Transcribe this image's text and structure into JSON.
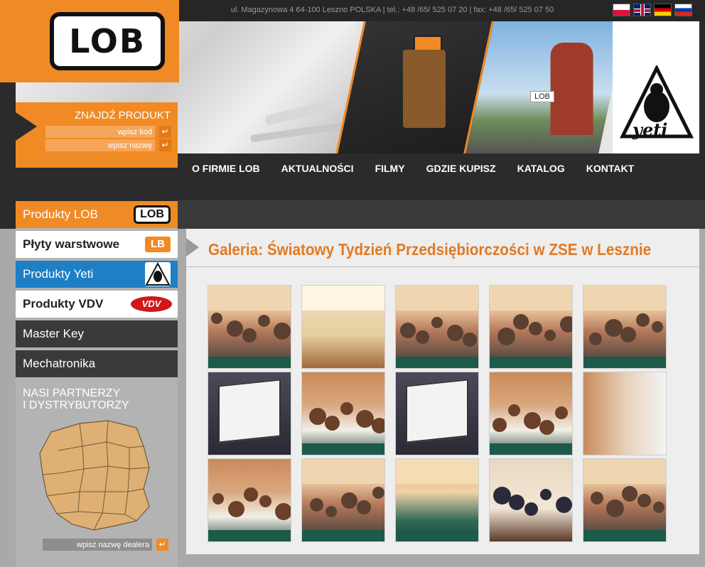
{
  "header": {
    "address": "ul. Magazynowa 4 64-100 Leszno POLSKA | tel.: +48 /65/ 525 07 20 | fax: +48 /65/ 525 07 50",
    "logo_text": "LOB",
    "flags": [
      "pl-flag-icon",
      "uk-flag-icon",
      "de-flag-icon",
      "ru-flag-icon"
    ]
  },
  "banner": {
    "lob_tag": "LOB",
    "yeti_text": "yeti"
  },
  "finder": {
    "title": "ZNAJDŹ PRODUKT",
    "code_placeholder": "wpisz kod",
    "name_placeholder": "wpisz nazwę"
  },
  "nav": {
    "items": [
      "O FIRMIE LOB",
      "AKTUALNOŚCI",
      "FILMY",
      "GDZIE KUPISZ",
      "KATALOG",
      "KONTAKT"
    ]
  },
  "sidebar": {
    "items": [
      {
        "label": "Produkty LOB",
        "badge": "LOB"
      },
      {
        "label": "Płyty warstwowe",
        "badge": "LB"
      },
      {
        "label": "Produkty Yeti",
        "badge": "yeti"
      },
      {
        "label": "Produkty VDV",
        "badge": "VDV"
      },
      {
        "label": "Master Key"
      },
      {
        "label": "Mechatronika"
      }
    ],
    "partners_title_line1": "NASI PARTNERZY",
    "partners_title_line2": "I DYSTRYBUTORZY",
    "dealer_placeholder": "wpisz nazwę dealera"
  },
  "gallery": {
    "title": "Galeria: Światowy Tydzień Przedsiębiorczości w ZSE w Lesznie",
    "thumbnails": [
      "audience-photo",
      "stage-piano-photo",
      "audience-photo",
      "audience-photo",
      "audience-photo",
      "presentation-screen-photo",
      "students-photo",
      "presentation-screen-photo",
      "students-photo",
      "lob-slide-photo",
      "students-photo",
      "audience-photo",
      "classroom-photo",
      "speaker-photo",
      "audience-photo"
    ]
  },
  "colors": {
    "brand_orange": "#f08a24",
    "title_orange": "#e07a24",
    "yeti_blue": "#1e7fc4",
    "dark": "#2b2b2b"
  }
}
